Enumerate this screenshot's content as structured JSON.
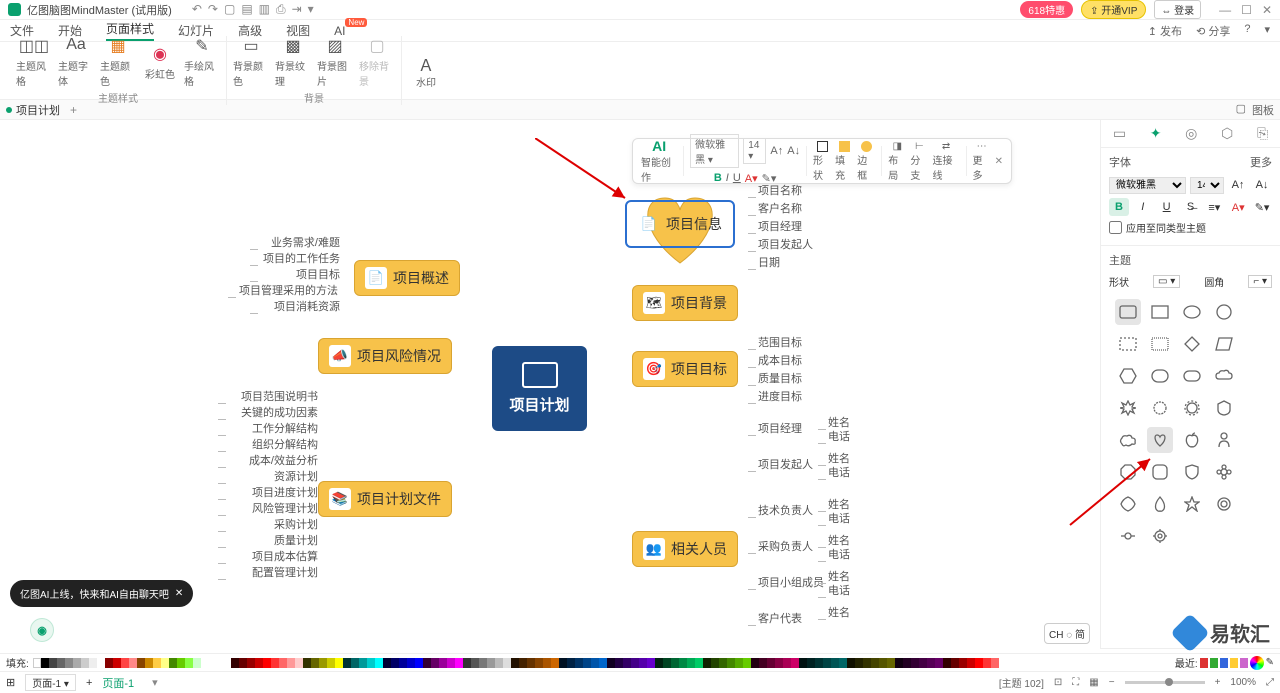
{
  "titlebar": {
    "title": "亿图脑图MindMaster (试用版)",
    "badge618": "618特惠",
    "vip": "⇪ 开通VIP",
    "login": "⇔ 登录"
  },
  "menu": {
    "items": [
      "文件",
      "开始",
      "页面样式",
      "幻灯片",
      "高级",
      "视图",
      "AI"
    ],
    "active_index": 2,
    "right": {
      "publish": "↥ 发布",
      "share": "⟲ 分享"
    }
  },
  "ribbon": {
    "g1": {
      "items": [
        "主题风格",
        "主题字体",
        "主题颜色",
        "彩虹色",
        "手绘风格"
      ],
      "label": "主题样式"
    },
    "g2": {
      "items": [
        "背景颜色",
        "背景纹理",
        "背景图片",
        "移除背景"
      ],
      "label": "背景"
    },
    "g3": {
      "items": [
        "水印"
      ],
      "label": ""
    }
  },
  "tab": {
    "name": "项目计划",
    "add": "+",
    "panel": "图板"
  },
  "canvas": {
    "center": "项目计划",
    "left_branches": [
      {
        "label": "项目概述",
        "leaves": [
          "业务需求/难题",
          "项目的工作任务",
          "项目目标",
          "项目管理采用的方法",
          "项目消耗资源"
        ]
      },
      {
        "label": "项目风险情况",
        "leaves": []
      },
      {
        "label": "项目计划文件",
        "leaves": [
          "项目范围说明书",
          "关键的成功因素",
          "工作分解结构",
          "组织分解结构",
          "成本/效益分析",
          "资源计划",
          "项目进度计划",
          "风险管理计划",
          "采购计划",
          "质量计划",
          "项目成本估算",
          "配置管理计划"
        ]
      }
    ],
    "right_branches": [
      {
        "label": "项目信息",
        "selected": true,
        "leaves": [
          "项目名称",
          "客户名称",
          "项目经理",
          "项目发起人",
          "日期"
        ]
      },
      {
        "label": "项目背景",
        "leaves": []
      },
      {
        "label": "项目目标",
        "leaves": [
          "范围目标",
          "成本目标",
          "质量目标",
          "进度目标"
        ]
      },
      {
        "label": "相关人员",
        "people": [
          {
            "role": "项目经理",
            "fields": [
              "姓名",
              "电话"
            ]
          },
          {
            "role": "项目发起人",
            "fields": [
              "姓名",
              "电话"
            ]
          },
          {
            "role": "技术负责人",
            "fields": [
              "姓名",
              "电话"
            ]
          },
          {
            "role": "采购负责人",
            "fields": [
              "姓名",
              "电话"
            ]
          },
          {
            "role": "项目小组成员",
            "fields": [
              "姓名",
              "电话"
            ]
          },
          {
            "role": "客户代表",
            "fields": [
              "姓名"
            ]
          }
        ]
      }
    ]
  },
  "float": {
    "ai": "AI",
    "ai_lbl": "智能创作",
    "font": "微软雅黑",
    "size": "14",
    "shape": "形状",
    "fill": "填充",
    "border": "边框",
    "layout": "布局",
    "branch": "分支",
    "connector": "连接线",
    "more": "更多"
  },
  "sidepanel": {
    "font_header": "字体",
    "more": "更多",
    "font_name": "微软雅黑",
    "font_size": "14",
    "apply_same": "应用至同类型主题",
    "topic_header": "主题",
    "shape_label": "形状",
    "corner_label": "圆角"
  },
  "toast": "亿图AI上线，快来和AI自由聊天吧",
  "lang_pill": "CH ◌ 简",
  "watermark_text": "易软汇",
  "fill_label": "填充:",
  "recent_label": "最近:",
  "status": {
    "page_sel": "页面-1",
    "page_sheet": "页面-1",
    "topic_count": "[主题 102]",
    "zoom": "100%"
  }
}
